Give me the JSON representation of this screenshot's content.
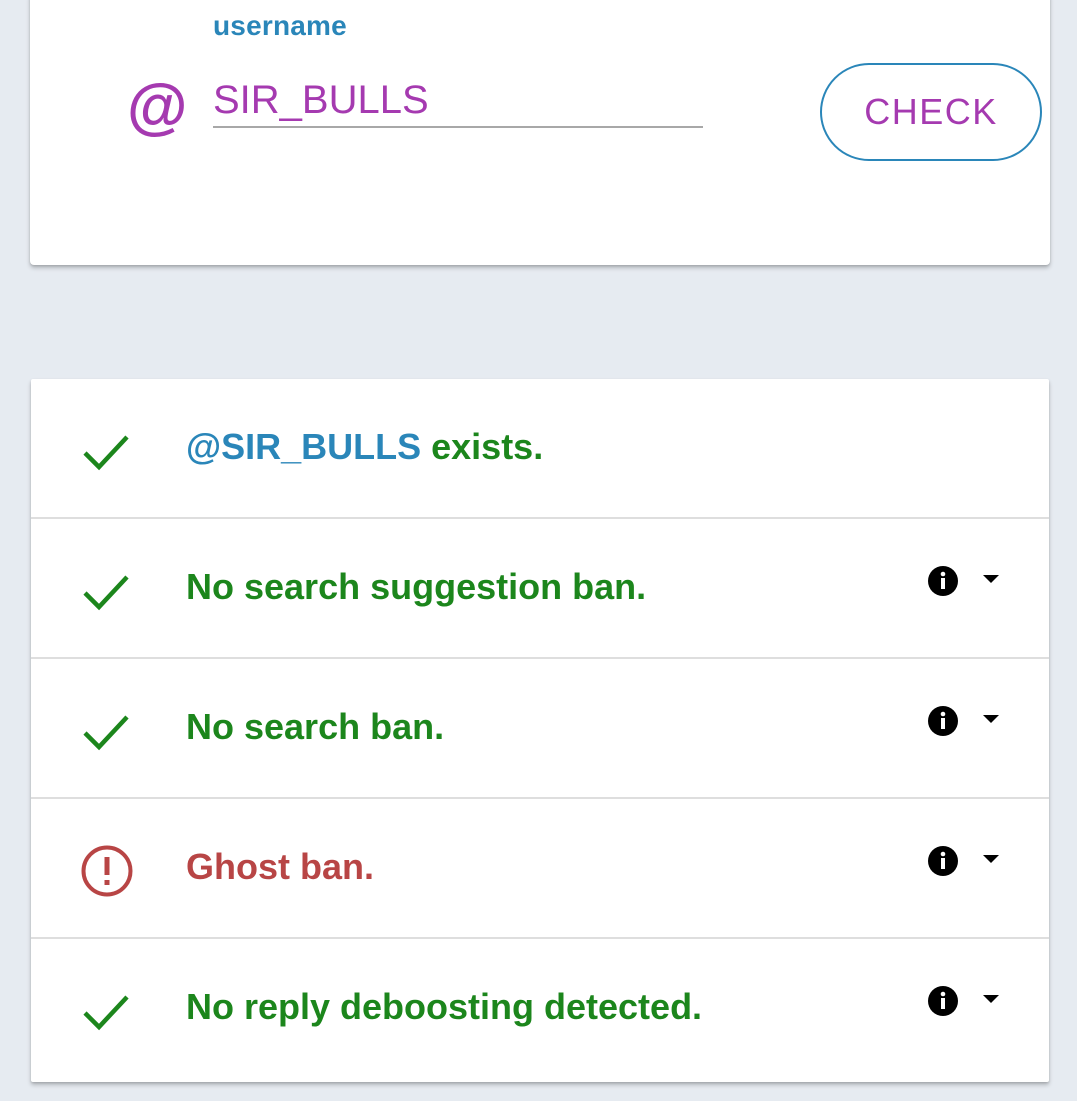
{
  "search": {
    "label": "username",
    "prefix_symbol": "@",
    "value": "SIR_BULLS",
    "button_label": "CHECK"
  },
  "colors": {
    "accent_purple": "#a53ab0",
    "accent_blue": "#2a86b9",
    "success_green": "#1c861c",
    "error_red": "#b84545",
    "background": "#e6ebf1"
  },
  "results": [
    {
      "status": "ok",
      "icon": "check-icon",
      "handle": "@SIR_BULLS",
      "text": " exists.",
      "has_info": false
    },
    {
      "status": "ok",
      "icon": "check-icon",
      "text": "No search suggestion ban.",
      "has_info": true
    },
    {
      "status": "ok",
      "icon": "check-icon",
      "text": "No search ban.",
      "has_info": true
    },
    {
      "status": "error",
      "icon": "alert-circle-icon",
      "text": "Ghost ban.",
      "has_info": true
    },
    {
      "status": "ok",
      "icon": "check-icon",
      "text": "No reply deboosting detected.",
      "has_info": true
    }
  ]
}
